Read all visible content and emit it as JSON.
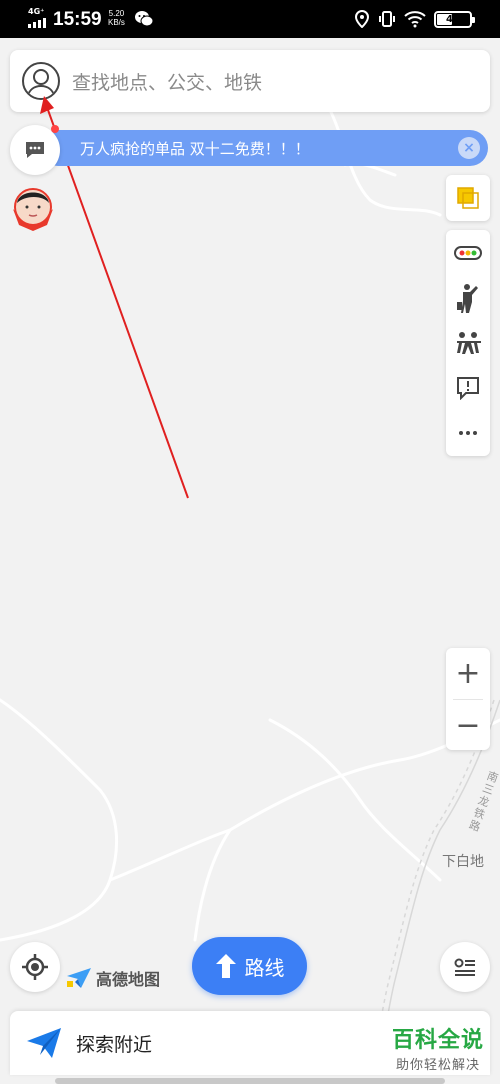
{
  "status_bar": {
    "network": "4G⁺",
    "time": "15:59",
    "speed_value": "5.20",
    "speed_unit": "KB/s",
    "battery": "46"
  },
  "search": {
    "placeholder": "查找地点、公交、地铁"
  },
  "banner": {
    "text": "万人疯抢的单品 双十二免费！！！",
    "close": "×"
  },
  "toolbar": {
    "items": [
      "layers-icon",
      "traffic-icon",
      "street-view-icon",
      "group-icon",
      "report-icon",
      "more-icon"
    ]
  },
  "zoom": {
    "in": "+",
    "out": "−"
  },
  "map_labels": {
    "place": "下白地",
    "road": "南三龙铁路"
  },
  "bottom": {
    "brand": "高德地图",
    "route_label": "路线",
    "nearby_label": "探索附近"
  },
  "watermark": {
    "title": "百科全说",
    "subtitle": "助你轻松解决"
  },
  "colors": {
    "accent": "#3c7ff5",
    "banner": "#6f9ef5",
    "annotation_arrow": "#e02020",
    "watermark": "#27a844"
  }
}
